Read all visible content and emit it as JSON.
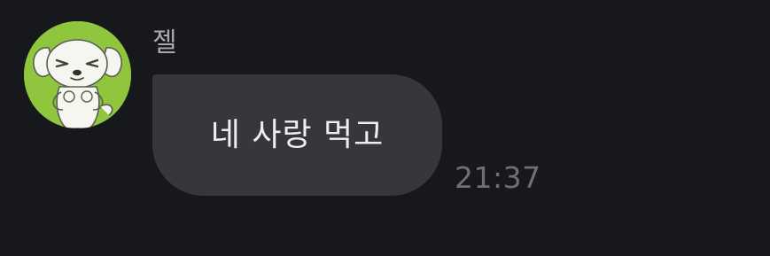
{
  "chat": {
    "message": {
      "sender_name": "젤",
      "avatar_icon": "puppy-character-avatar",
      "text": "네 사랑 먹고",
      "time": "21:37"
    }
  },
  "colors": {
    "background": "#17181c",
    "bubble": "#36373c",
    "avatar_background": "#8fc63d",
    "sender_name": "#a7a8ad",
    "message_text": "#eeeef0",
    "timestamp": "#6f7076"
  }
}
